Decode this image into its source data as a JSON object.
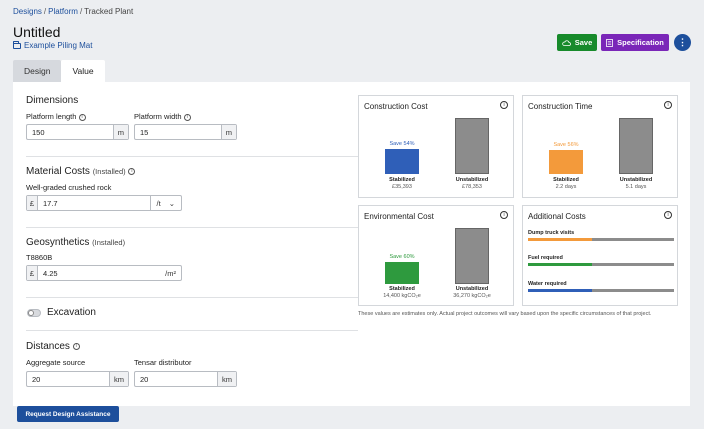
{
  "breadcrumb": {
    "items": [
      "Designs",
      "Platform",
      "Tracked Plant"
    ]
  },
  "page_title": "Untitled",
  "mat_link": "Example Piling Mat",
  "toolbar": {
    "save_label": "Save",
    "spec_label": "Specification",
    "more_label": "⋮"
  },
  "tabs": [
    {
      "label": "Design"
    },
    {
      "label": "Value"
    }
  ],
  "dimensions": {
    "title": "Dimensions",
    "length_label": "Platform length",
    "length_value": "150",
    "length_unit": "m",
    "width_label": "Platform width",
    "width_value": "15",
    "width_unit": "m"
  },
  "material": {
    "title": "Material Costs",
    "title_sub": "(Installed)",
    "item_label": "Well-graded crushed rock",
    "currency": "£",
    "value": "17.7",
    "unit": "/t",
    "chevron": "⌄"
  },
  "geo": {
    "title": "Geosynthetics",
    "title_sub": "(Installed)",
    "item_label": "T8860B",
    "currency": "£",
    "value": "4.25",
    "unit": "/m²"
  },
  "excavation": {
    "label": "Excavation"
  },
  "distances": {
    "title": "Distances",
    "agg_label": "Aggregate source",
    "agg_value": "20",
    "agg_unit": "km",
    "dist_label": "Tensar distributor",
    "dist_value": "20",
    "dist_unit": "km"
  },
  "cards": {
    "cost": {
      "title": "Construction Cost",
      "save": "Save 54%",
      "stab_label": "Stabilized",
      "stab_value": "£35,393",
      "unstab_label": "Unstabilized",
      "unstab_value": "£78,353",
      "stab_ratio": 0.452
    },
    "time": {
      "title": "Construction Time",
      "save": "Save 56%",
      "stab_label": "Stabilized",
      "stab_value": "2.2 days",
      "unstab_label": "Unstabilized",
      "unstab_value": "5.1 days",
      "stab_ratio": 0.431
    },
    "env": {
      "title": "Environmental Cost",
      "save": "Save 60%",
      "stab_label": "Stabilized",
      "stab_value": "14,400 kgCO₂e",
      "unstab_label": "Unstabilized",
      "unstab_value": "36,270 kgCO₂e",
      "stab_ratio": 0.397
    },
    "additional": {
      "title": "Additional Costs",
      "items": [
        {
          "label": "Dump truck visits",
          "fraction": 0.44,
          "color": "#f39a3b"
        },
        {
          "label": "Fuel required",
          "fraction": 0.44,
          "color": "#2e9a3e"
        },
        {
          "label": "Water required",
          "fraction": 0.44,
          "color": "#2f5fb8"
        }
      ]
    }
  },
  "colors": {
    "cost": "#2f5fb8",
    "time": "#f39a3b",
    "env": "#2e9a3e",
    "unstab": "#8c8c8c",
    "track": "#8c8c8c"
  },
  "disclaimer": "These values are estimates only. Actual project outcomes will vary based upon the specific circumstances of that project.",
  "assist_label": "Request Design Assistance"
}
